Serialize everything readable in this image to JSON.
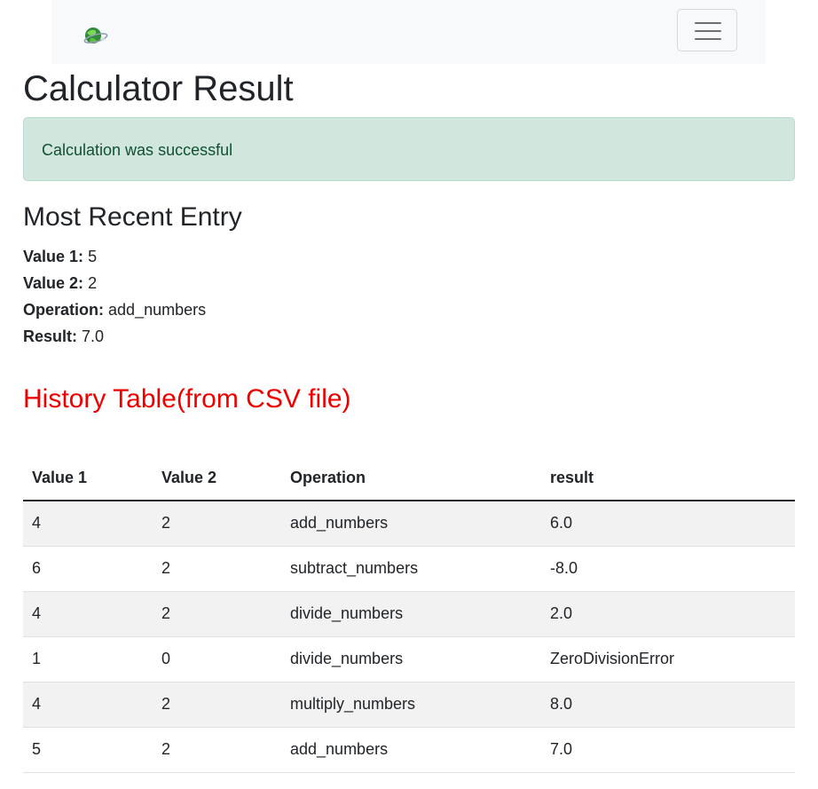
{
  "page": {
    "title": "Calculator Result"
  },
  "alert": {
    "message": "Calculation was successful"
  },
  "recent": {
    "heading": "Most Recent Entry",
    "value1_label": "Value 1:",
    "value1": "5",
    "value2_label": "Value 2:",
    "value2": "2",
    "operation_label": "Operation:",
    "operation": "add_numbers",
    "result_label": "Result:",
    "result": "7.0"
  },
  "history": {
    "heading": "History Table(from CSV file)",
    "columns": [
      "Value 1",
      "Value 2",
      "Operation",
      "result"
    ],
    "rows": [
      [
        "4",
        "2",
        "add_numbers",
        "6.0"
      ],
      [
        "6",
        "2",
        "subtract_numbers",
        "-8.0"
      ],
      [
        "4",
        "2",
        "divide_numbers",
        "2.0"
      ],
      [
        "1",
        "0",
        "divide_numbers",
        "ZeroDivisionError"
      ],
      [
        "4",
        "2",
        "multiply_numbers",
        "8.0"
      ],
      [
        "5",
        "2",
        "add_numbers",
        "7.0"
      ]
    ]
  },
  "colors": {
    "alert_bg": "#d1e7dd",
    "alert_text": "#0f5132",
    "history_heading": "#ee0000",
    "navbar_bg": "#f8f9fa"
  },
  "icons": {
    "logo": "globe-logo-icon",
    "menu": "hamburger-menu-icon"
  }
}
